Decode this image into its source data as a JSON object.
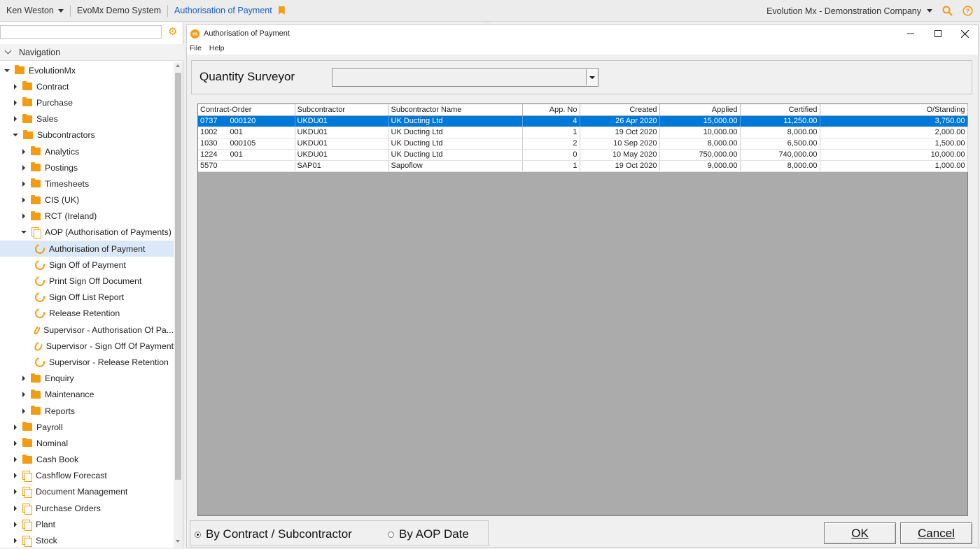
{
  "topbar": {
    "user": "Ken Weston",
    "system": "EvoMx Demo System",
    "active_page": "Authorisation of Payment",
    "company": "Evolution Mx - Demonstration Company",
    "grip": "....."
  },
  "sidebar": {
    "search_placeholder": "",
    "nav_header": "Navigation",
    "items": [
      {
        "label": "EvolutionMx",
        "level": 0,
        "expand": "down",
        "icon": "folder-icon"
      },
      {
        "label": "Contract",
        "level": 1,
        "expand": "right",
        "icon": "folder-icon"
      },
      {
        "label": "Purchase",
        "level": 1,
        "expand": "right",
        "icon": "folder-icon"
      },
      {
        "label": "Sales",
        "level": 1,
        "expand": "right",
        "icon": "folder-icon"
      },
      {
        "label": "Subcontractors",
        "level": 1,
        "expand": "down",
        "icon": "folder-icon"
      },
      {
        "label": "Analytics",
        "level": 2,
        "expand": "right",
        "icon": "folder-icon"
      },
      {
        "label": "Postings",
        "level": 2,
        "expand": "right",
        "icon": "folder-icon"
      },
      {
        "label": "Timesheets",
        "level": 2,
        "expand": "right",
        "icon": "folder-icon"
      },
      {
        "label": "CIS (UK)",
        "level": 2,
        "expand": "right",
        "icon": "folder-icon"
      },
      {
        "label": "RCT (Ireland)",
        "level": 2,
        "expand": "right",
        "icon": "folder-icon"
      },
      {
        "label": "AOP (Authorisation of Payments)",
        "level": 2,
        "expand": "down",
        "icon": "documents-icon"
      },
      {
        "label": "Authorisation of Payment",
        "level": 3,
        "expand": "none",
        "icon": "progress-icon",
        "selected": true
      },
      {
        "label": "Sign Off of Payment",
        "level": 3,
        "expand": "none",
        "icon": "progress-icon"
      },
      {
        "label": "Print Sign Off Document",
        "level": 3,
        "expand": "none",
        "icon": "progress-icon"
      },
      {
        "label": "Sign Off List Report",
        "level": 3,
        "expand": "none",
        "icon": "progress-icon"
      },
      {
        "label": "Release Retention",
        "level": 3,
        "expand": "none",
        "icon": "progress-icon"
      },
      {
        "label": "Supervisor - Authorisation Of Pa...",
        "level": 3,
        "expand": "none",
        "icon": "progress-icon"
      },
      {
        "label": "Supervisor - Sign Off Of Payment",
        "level": 3,
        "expand": "none",
        "icon": "progress-icon"
      },
      {
        "label": "Supervisor - Release Retention",
        "level": 3,
        "expand": "none",
        "icon": "progress-icon"
      },
      {
        "label": "Enquiry",
        "level": 2,
        "expand": "right",
        "icon": "folder-icon"
      },
      {
        "label": "Maintenance",
        "level": 2,
        "expand": "right",
        "icon": "folder-icon"
      },
      {
        "label": "Reports",
        "level": 2,
        "expand": "right",
        "icon": "folder-icon"
      },
      {
        "label": "Payroll",
        "level": 1,
        "expand": "right",
        "icon": "folder-icon"
      },
      {
        "label": "Nominal",
        "level": 1,
        "expand": "right",
        "icon": "folder-icon"
      },
      {
        "label": "Cash Book",
        "level": 1,
        "expand": "right",
        "icon": "folder-icon"
      },
      {
        "label": "Cashflow Forecast",
        "level": 1,
        "expand": "right",
        "icon": "documents-icon"
      },
      {
        "label": "Document Management",
        "level": 1,
        "expand": "right",
        "icon": "documents-icon"
      },
      {
        "label": "Purchase Orders",
        "level": 1,
        "expand": "right",
        "icon": "documents-icon"
      },
      {
        "label": "Plant",
        "level": 1,
        "expand": "right",
        "icon": "documents-icon"
      },
      {
        "label": "Stock",
        "level": 1,
        "expand": "right",
        "icon": "documents-icon"
      }
    ]
  },
  "window": {
    "title": "Authorisation of Payment",
    "logo_letter": "m",
    "menu": [
      "File",
      "Help"
    ],
    "qs_label": "Quantity Surveyor",
    "qs_value": "",
    "columns": [
      "Contract-Order",
      "Subcontractor",
      "Subcontractor Name",
      "App. No",
      "Created",
      "Applied",
      "Certified",
      "O/Standing"
    ],
    "rows": [
      {
        "contract": "0737",
        "order": "000120",
        "sub": "UKDU01",
        "name": "UK Ducting Ltd",
        "app": "4",
        "created": "26 Apr 2020",
        "applied": "15,000.00",
        "certified": "11,250.00",
        "outstanding": "3,750.00",
        "selected": true
      },
      {
        "contract": "1002",
        "order": "001",
        "sub": "UKDU01",
        "name": "UK Ducting Ltd",
        "app": "1",
        "created": "19 Oct 2020",
        "applied": "10,000.00",
        "certified": "8,000.00",
        "outstanding": "2,000.00"
      },
      {
        "contract": "1030",
        "order": "000105",
        "sub": "UKDU01",
        "name": "UK Ducting Ltd",
        "app": "2",
        "created": "10 Sep 2020",
        "applied": "8,000.00",
        "certified": "6,500.00",
        "outstanding": "1,500.00"
      },
      {
        "contract": "1224",
        "order": "001",
        "sub": "UKDU01",
        "name": "UK Ducting Ltd",
        "app": "0",
        "created": "10 May 2020",
        "applied": "750,000.00",
        "certified": "740,000.00",
        "outstanding": "10,000.00"
      },
      {
        "contract": "5570",
        "order": "",
        "sub": "SAP01",
        "name": "Sapoflow",
        "app": "1",
        "created": "19 Oct 2020",
        "applied": "9,000.00",
        "certified": "8,000.00",
        "outstanding": "1,000.00"
      }
    ],
    "radio_by_contract": "By Contract / Subcontractor",
    "radio_by_date": "By AOP Date",
    "ok_label": "OK",
    "cancel_label": "Cancel"
  },
  "colors": {
    "accent": "#f39c12",
    "selection": "#0078d7",
    "link": "#1a5fc4"
  }
}
